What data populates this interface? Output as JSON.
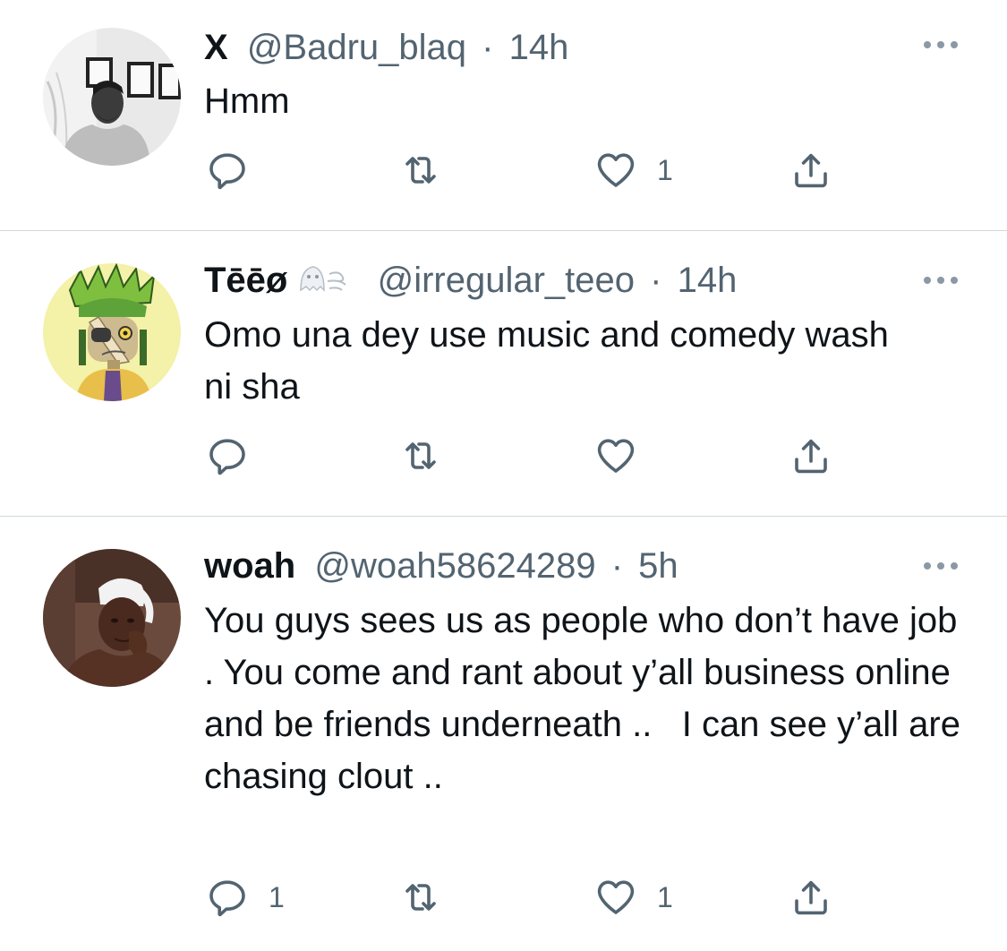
{
  "tweets": [
    {
      "display_name": "X",
      "handle": "@Badru_blaq",
      "separator": "·",
      "time": "14h",
      "text": "Hmm",
      "reply_count": "",
      "retweet_count": "",
      "like_count": "1",
      "avatar": "man-in-white-shirt-grayscale-avatar"
    },
    {
      "display_name": "Tēēø",
      "handle": "@irregular_teeo",
      "separator": "·",
      "time": "14h",
      "text": "Omo una dey use music and comedy wash ni sha",
      "reply_count": "",
      "retweet_count": "",
      "like_count": "",
      "avatar": "cartoon-character-avatar",
      "name_emoji": "ghost-and-wind-emoji"
    },
    {
      "display_name": "woah",
      "handle": "@woah58624289",
      "separator": "·",
      "time": "5h",
      "text": "You guys sees us as people who don’t have job . You come and rant about y’all business online and be friends underneath ..   I can see y’all are chasing clout ..",
      "reply_count": "1",
      "retweet_count": "",
      "like_count": "1",
      "avatar": "man-in-white-durag-avatar"
    }
  ],
  "icons": {
    "reply": "reply-icon",
    "retweet": "retweet-icon",
    "like": "heart-icon",
    "share": "share-icon",
    "more": "more-options-icon"
  },
  "colors": {
    "text": "#0f1419",
    "secondary": "#536471",
    "divider": "#cfd9de"
  }
}
